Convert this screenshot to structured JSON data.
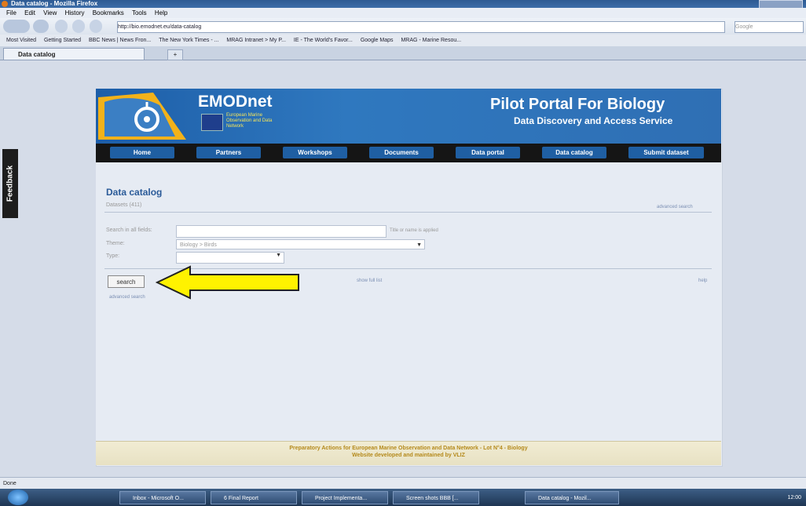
{
  "window": {
    "title": "Data catalog - Mozilla Firefox"
  },
  "menu": [
    "File",
    "Edit",
    "View",
    "History",
    "Bookmarks",
    "Tools",
    "Help"
  ],
  "url": "http://bio.emodnet.eu/data-catalog",
  "search_engine_placeholder": "Google",
  "bookmarks": [
    "Most Visited",
    "Getting Started",
    "BBC News | News Fron...",
    "The New York Times - ...",
    "MRAG Intranet > My P...",
    "IE - The World's Favor...",
    "Google Maps",
    "MRAG - Marine Resou..."
  ],
  "tab": {
    "label": "Data catalog",
    "new_tab": "+"
  },
  "feedback": "Feedback",
  "site": {
    "brand": "EMODnet",
    "brand_sub": "European Marine Observation and Data Network",
    "portal_title": "Pilot Portal For Biology",
    "portal_sub": "Data Discovery and Access Service",
    "nav": [
      "Home",
      "Partners",
      "Workshops",
      "Documents",
      "Data portal",
      "Data catalog",
      "Submit dataset"
    ]
  },
  "catalog": {
    "heading": "Data catalog",
    "datasets": "Datasets (411)",
    "advanced_search_top": "advanced search",
    "fields": {
      "search_label": "Search in all fields:",
      "hint": "Title or name is applied",
      "theme_label": "Theme:",
      "theme_value": "Biology > Birds",
      "type_label": "Type:"
    },
    "search_button": "search",
    "advanced_search_bottom": "advanced search",
    "show_full_list": "show full list",
    "help": "help"
  },
  "footer": {
    "line1": "Preparatory Actions for European Marine Observation and Data Network - Lot N°4 - Biology",
    "line2": "Website developed and maintained by VLIZ"
  },
  "status": "Done",
  "taskbar": [
    "Inbox - Microsoft O...",
    "6 Final Report",
    "Project Implementa...",
    "Screen shots BBB [...",
    "Data catalog - Mozil..."
  ],
  "clock": "12:00"
}
